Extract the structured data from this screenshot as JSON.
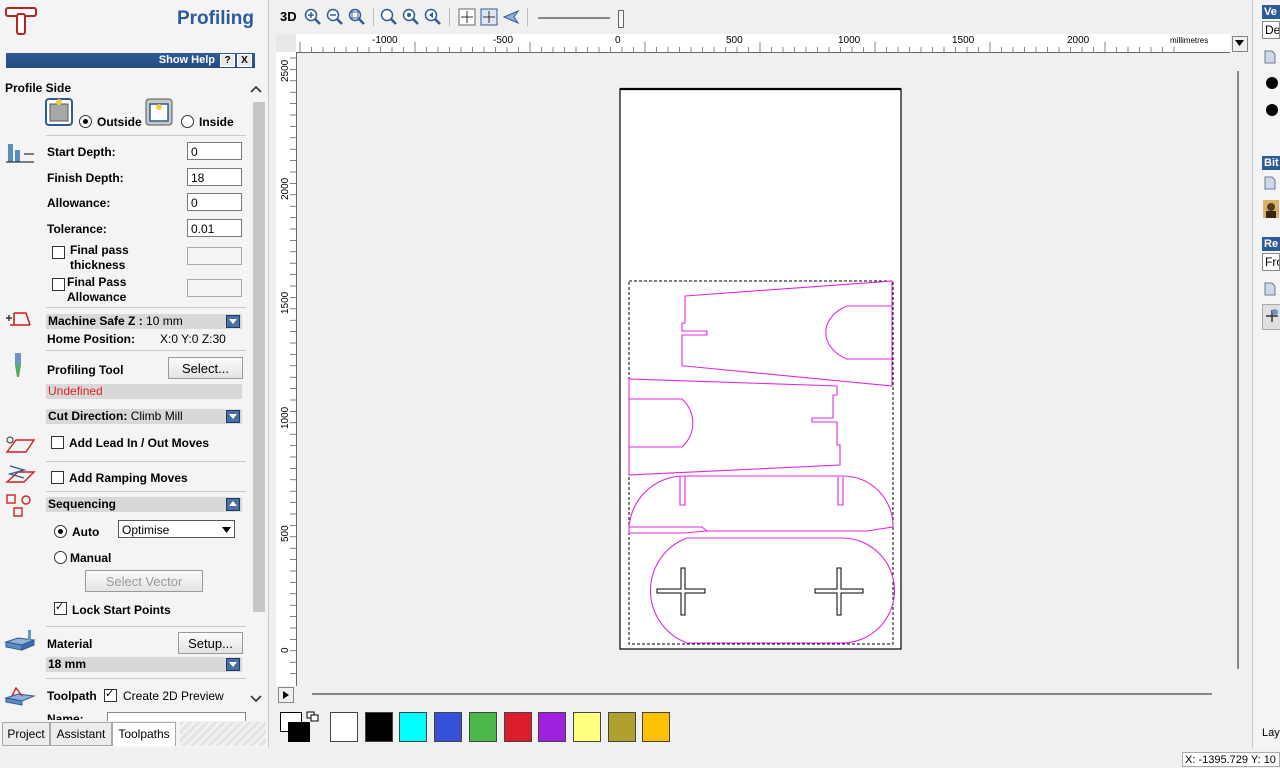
{
  "panel": {
    "title": "Profiling",
    "show_help": "Show Help",
    "help_btn": "?",
    "close_btn": "X",
    "profile_side": {
      "label": "Profile Side",
      "outside": "Outside",
      "inside": "Inside",
      "selected": "outside"
    },
    "cutting_depths": {
      "start_depth_label": "Start Depth:",
      "start_depth": "0",
      "finish_depth_label": "Finish Depth:",
      "finish_depth": "18",
      "allowance_label": "Allowance:",
      "allowance": "0",
      "tolerance_label": "Tolerance:",
      "tolerance": "0.01",
      "final_pass_thickness_1": "Final pass",
      "final_pass_thickness_2": "thickness",
      "final_pass_allowance_1": "Final Pass",
      "final_pass_allowance_2": "Allowance"
    },
    "machine": {
      "safe_z_label": "Machine Safe Z :",
      "safe_z": "10 mm",
      "home_label": "Home Position:",
      "home": "X:0 Y:0 Z:30"
    },
    "tool": {
      "label": "Profiling Tool",
      "select_btn": "Select...",
      "status": "Undefined"
    },
    "cut_direction": {
      "label": "Cut Direction:",
      "value": "Climb Mill"
    },
    "lead_label": "Add Lead In / Out Moves",
    "ramp_label": "Add Ramping Moves",
    "sequencing": {
      "label": "Sequencing",
      "auto": "Auto",
      "auto_option": "Optimise",
      "manual": "Manual",
      "select_vector": "Select Vector",
      "lock_start": "Lock Start Points"
    },
    "material": {
      "label": "Material",
      "setup_btn": "Setup...",
      "thickness": "18 mm"
    },
    "toolpath": {
      "label": "Toolpath",
      "create_preview": "Create 2D Preview",
      "name_label": "Name:"
    },
    "tabs": [
      "Project",
      "Assistant",
      "Toolpaths"
    ]
  },
  "toolbar": {
    "three_d": "3D"
  },
  "ruler": {
    "units": "millimetres",
    "h_labels": [
      "-1000",
      "-500",
      "0",
      "500",
      "1000",
      "1500",
      "2000"
    ],
    "v_labels": [
      "2500",
      "2000",
      "1500",
      "1000",
      "500",
      "0"
    ]
  },
  "colors": {
    "vector": "#e028e0",
    "accent": "#2f5b95",
    "swatches": [
      "#ffffff",
      "#000000",
      "#00ffff",
      "#3650d8",
      "#4cb84c",
      "#dc1c2c",
      "#a020e0",
      "#ffff80",
      "#b0a030",
      "#ffc000"
    ]
  },
  "right_panel": {
    "h1": "Ve",
    "box1": "De",
    "h2": "Bit",
    "h3": "Re",
    "box3": "Fro",
    "bottom": "Lay"
  },
  "status": {
    "coords": "X: -1395.729 Y: 10"
  }
}
